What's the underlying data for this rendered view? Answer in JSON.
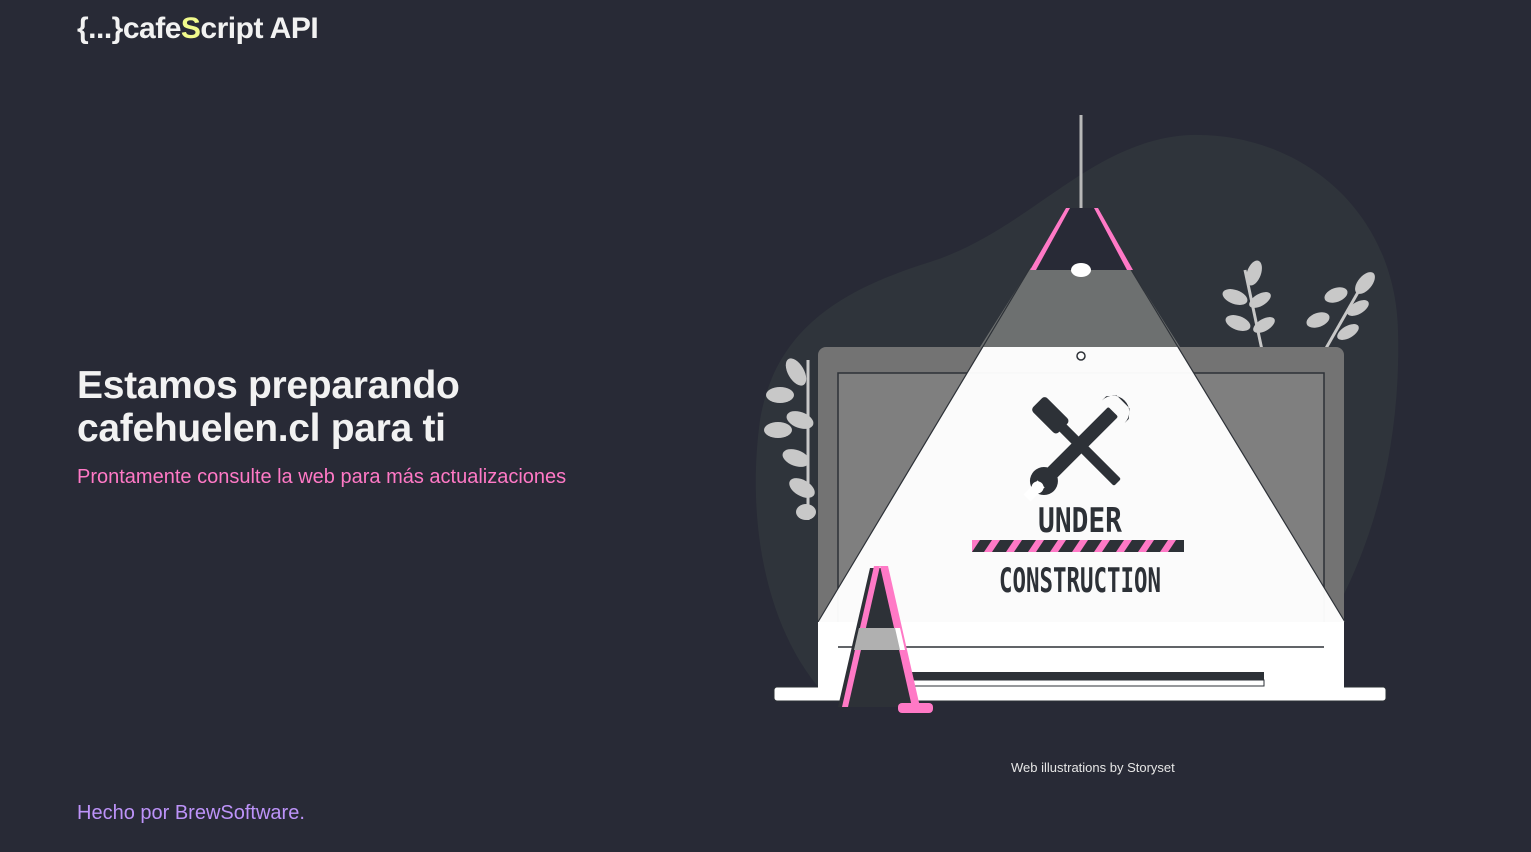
{
  "header": {
    "logo_prefix": "{...}cafe",
    "logo_accent": "S",
    "logo_suffix": "cript API"
  },
  "hero": {
    "title_line1": "Estamos preparando",
    "title_line2": "cafehuelen.cl para ti",
    "subtitle": "Prontamente consulte la web para más actualizaciones"
  },
  "illustration": {
    "text_top": "UNDER",
    "text_bottom": "CONSTRUCTION",
    "icon": "wrench-screwdriver-icon"
  },
  "credit": "Web illustrations by Storyset",
  "footer": {
    "text": "Hecho por BrewSoftware."
  },
  "colors": {
    "background": "#282a36",
    "accent_pink": "#ff79c6",
    "accent_purple": "#bd93f9",
    "accent_yellow": "#f1fa8c"
  }
}
